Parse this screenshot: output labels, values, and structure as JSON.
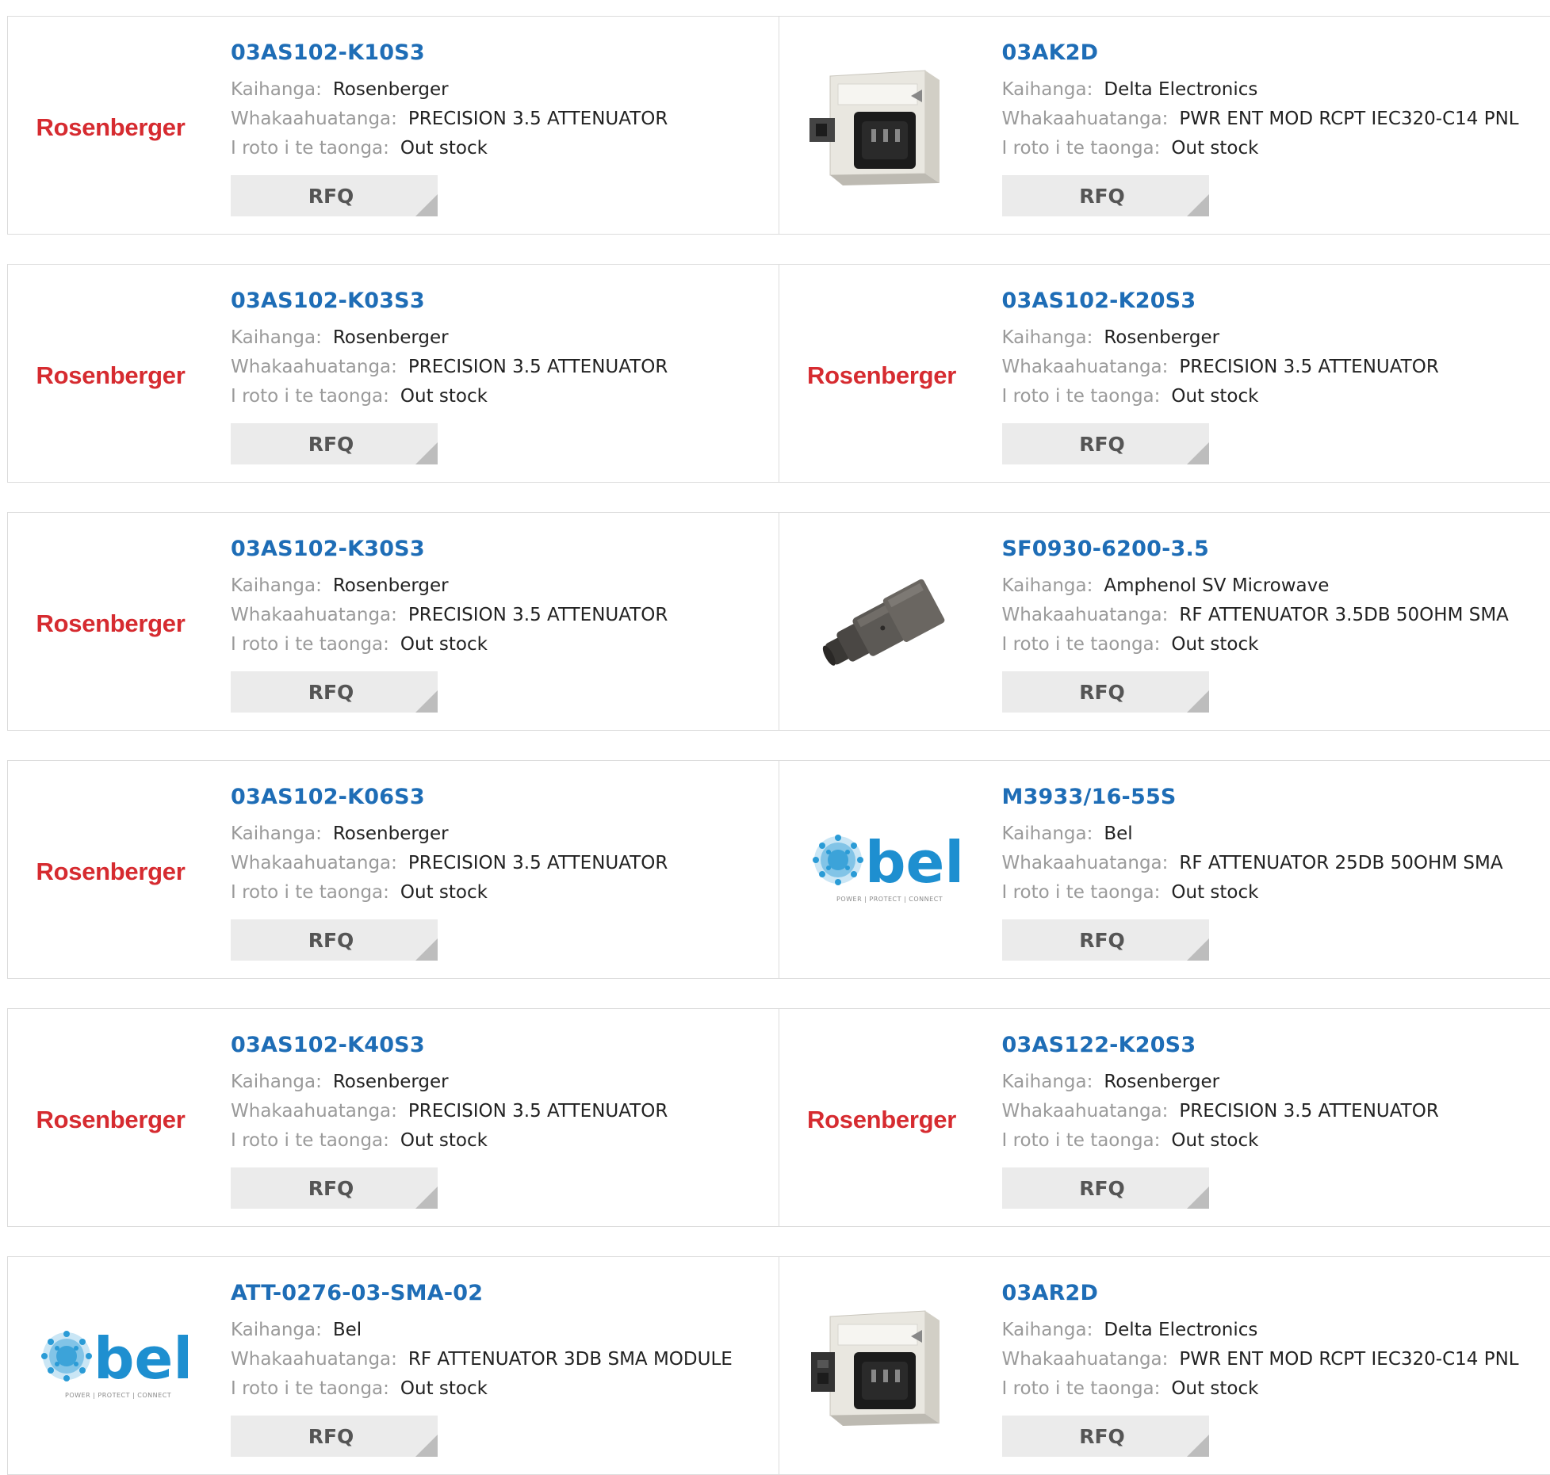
{
  "labels": {
    "manufacturer": "Kaihanga:",
    "description": "Whakaahuatanga:",
    "stock": "I roto i te taonga:",
    "rfq": "RFQ"
  },
  "brand_logos": {
    "rosenberger": "Rosenberger",
    "bel_word": "bel",
    "bel_tagline": "POWER | PROTECT | CONNECT"
  },
  "colors": {
    "part_link": "#1e6db6",
    "rosenberger_red": "#d62b30",
    "bel_blue": "#2a9bd6",
    "rfq_bg": "#ebebeb"
  },
  "products": [
    {
      "part": "03AS102-K10S3",
      "manufacturer": "Rosenberger",
      "description": "PRECISION 3.5 ATTENUATOR",
      "stock": "Out stock",
      "image": "rosenberger-logo"
    },
    {
      "part": "03AK2D",
      "manufacturer": "Delta Electronics",
      "description": "PWR ENT MOD RCPT IEC320-C14 PNL",
      "stock": "Out stock",
      "image": "power-entry-module-photo"
    },
    {
      "part": "03AS102-K03S3",
      "manufacturer": "Rosenberger",
      "description": "PRECISION 3.5 ATTENUATOR",
      "stock": "Out stock",
      "image": "rosenberger-logo"
    },
    {
      "part": "03AS102-K20S3",
      "manufacturer": "Rosenberger",
      "description": "PRECISION 3.5 ATTENUATOR",
      "stock": "Out stock",
      "image": "rosenberger-logo"
    },
    {
      "part": "03AS102-K30S3",
      "manufacturer": "Rosenberger",
      "description": "PRECISION 3.5 ATTENUATOR",
      "stock": "Out stock",
      "image": "rosenberger-logo"
    },
    {
      "part": "SF0930-6200-3.5",
      "manufacturer": "Amphenol SV Microwave",
      "description": "RF ATTENUATOR 3.5DB 50OHM SMA",
      "stock": "Out stock",
      "image": "rf-attenuator-photo"
    },
    {
      "part": "03AS102-K06S3",
      "manufacturer": "Rosenberger",
      "description": "PRECISION 3.5 ATTENUATOR",
      "stock": "Out stock",
      "image": "rosenberger-logo"
    },
    {
      "part": "M3933/16-55S",
      "manufacturer": "Bel",
      "description": "RF ATTENUATOR 25DB 50OHM SMA",
      "stock": "Out stock",
      "image": "bel-logo"
    },
    {
      "part": "03AS102-K40S3",
      "manufacturer": "Rosenberger",
      "description": "PRECISION 3.5 ATTENUATOR",
      "stock": "Out stock",
      "image": "rosenberger-logo"
    },
    {
      "part": "03AS122-K20S3",
      "manufacturer": "Rosenberger",
      "description": "PRECISION 3.5 ATTENUATOR",
      "stock": "Out stock",
      "image": "rosenberger-logo"
    },
    {
      "part": "ATT-0276-03-SMA-02",
      "manufacturer": "Bel",
      "description": "RF ATTENUATOR 3DB SMA MODULE",
      "stock": "Out stock",
      "image": "bel-logo"
    },
    {
      "part": "03AR2D",
      "manufacturer": "Delta Electronics",
      "description": "PWR ENT MOD RCPT IEC320-C14 PNL",
      "stock": "Out stock",
      "image": "power-entry-module-photo"
    }
  ]
}
